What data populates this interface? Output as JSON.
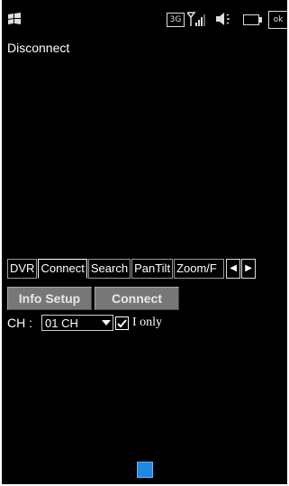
{
  "status_bar": {
    "network_label": "3G",
    "ok_label": "ok",
    "icons": [
      "windows-logo-icon",
      "signal-icon",
      "volume-icon",
      "battery-icon"
    ]
  },
  "main": {
    "status_text": "Disconnect"
  },
  "tabs": [
    {
      "label": "DVR"
    },
    {
      "label": "Connect"
    },
    {
      "label": "Search"
    },
    {
      "label": "PanTilt"
    },
    {
      "label": "Zoom/F"
    }
  ],
  "buttons": {
    "info_setup": "Info Setup",
    "connect": "Connect"
  },
  "channel": {
    "label": "CH :",
    "selected": "01 CH",
    "checkbox_label": "I only",
    "checked": true
  },
  "colors": {
    "background": "#000000",
    "button_gray": "#777777",
    "keyboard_blue": "#1e88e5"
  }
}
